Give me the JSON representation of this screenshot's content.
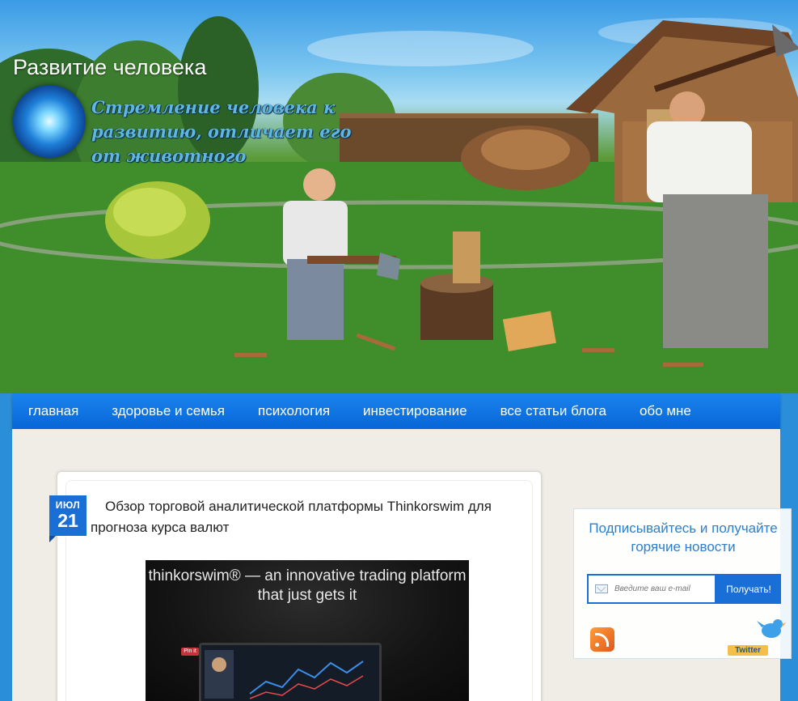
{
  "header": {
    "site_title": "Развитие человека",
    "tagline": "Стремление человека к развитию, отличает его от животного"
  },
  "nav": {
    "items": [
      {
        "label": "главная"
      },
      {
        "label": "здоровье и семья"
      },
      {
        "label": "психология"
      },
      {
        "label": "инвестирование"
      },
      {
        "label": "все статьи блога"
      },
      {
        "label": "обо мне"
      }
    ]
  },
  "post": {
    "date_month": "ИЮЛ",
    "date_day": "21",
    "title": "Обзор торговой аналитической платформы Thinkorswim для прогноза курса валют",
    "image_headline": "thinkorswim® — an innovative trading platform that just gets it",
    "image_badge": "Pin it"
  },
  "subscribe": {
    "heading": "Подписывайтесь и получайте горячие новости",
    "email_placeholder": "Введите ваш e-mail",
    "button_label": "Получать!",
    "twitter_label": "Twitter"
  },
  "colors": {
    "nav_bg": "#0866d6",
    "accent_blue": "#1a6fd6",
    "content_bg": "#efede6",
    "tagline": "#5fb6e0"
  },
  "icons": [
    "logo-orb",
    "mail-icon",
    "rss-icon",
    "twitter-icon"
  ]
}
